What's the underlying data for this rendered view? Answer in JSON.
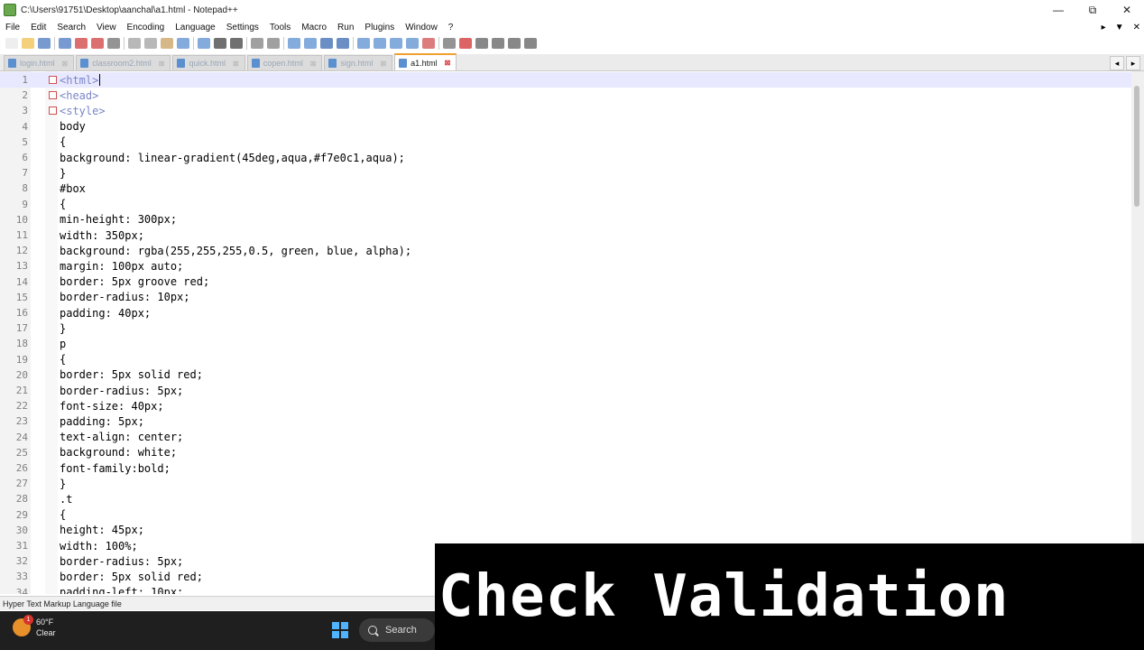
{
  "window": {
    "title": "C:\\Users\\91751\\Desktop\\aanchal\\a1.html - Notepad++",
    "minimize_glyph": "—",
    "maximize_glyph": "⧉",
    "close_glyph": "✕"
  },
  "menu": {
    "items": [
      "File",
      "Edit",
      "Search",
      "View",
      "Encoding",
      "Language",
      "Settings",
      "Tools",
      "Macro",
      "Run",
      "Plugins",
      "Window",
      "?"
    ],
    "right_controls": [
      "▸",
      "▼",
      "✕"
    ]
  },
  "tabs": [
    {
      "label": "login.html",
      "active": false
    },
    {
      "label": "classroom2.html",
      "active": false
    },
    {
      "label": "quick.html",
      "active": false
    },
    {
      "label": "copen.html",
      "active": false
    },
    {
      "label": "sign.html",
      "active": false
    },
    {
      "label": "a1.html",
      "active": true
    }
  ],
  "tab_scroll": [
    "◂",
    "▸"
  ],
  "editor": {
    "lines": [
      {
        "num": "1",
        "text": "<html>",
        "tag": true,
        "fold": "box",
        "current": true
      },
      {
        "num": "2",
        "text": "<head>",
        "tag": true,
        "fold": "box"
      },
      {
        "num": "3",
        "text": "<style>",
        "tag": true,
        "fold": "box"
      },
      {
        "num": "4",
        "text": "body"
      },
      {
        "num": "5",
        "text": "{"
      },
      {
        "num": "6",
        "text": "background: linear-gradient(45deg,aqua,#f7e0c1,aqua);"
      },
      {
        "num": "7",
        "text": "}"
      },
      {
        "num": "8",
        "text": "#box"
      },
      {
        "num": "9",
        "text": "{"
      },
      {
        "num": "10",
        "text": "min-height: 300px;"
      },
      {
        "num": "11",
        "text": "width: 350px;"
      },
      {
        "num": "12",
        "text": "background: rgba(255,255,255,0.5, green, blue, alpha);"
      },
      {
        "num": "13",
        "text": "margin: 100px auto;"
      },
      {
        "num": "14",
        "text": "border: 5px groove red;"
      },
      {
        "num": "15",
        "text": "border-radius: 10px;"
      },
      {
        "num": "16",
        "text": "padding: 40px;"
      },
      {
        "num": "17",
        "text": "}"
      },
      {
        "num": "18",
        "text": "p"
      },
      {
        "num": "19",
        "text": "{"
      },
      {
        "num": "20",
        "text": "border: 5px solid red;"
      },
      {
        "num": "21",
        "text": "border-radius: 5px;"
      },
      {
        "num": "22",
        "text": "font-size: 40px;"
      },
      {
        "num": "23",
        "text": "padding: 5px;"
      },
      {
        "num": "24",
        "text": "text-align: center;"
      },
      {
        "num": "25",
        "text": "background: white;"
      },
      {
        "num": "26",
        "text": "font-family:bold;"
      },
      {
        "num": "27",
        "text": "}"
      },
      {
        "num": "28",
        "text": ".t"
      },
      {
        "num": "29",
        "text": "{"
      },
      {
        "num": "30",
        "text": "height: 45px;"
      },
      {
        "num": "31",
        "text": "width: 100%;"
      },
      {
        "num": "32",
        "text": "border-radius: 5px;"
      },
      {
        "num": "33",
        "text": "border: 5px solid red;"
      },
      {
        "num": "34",
        "text": "padding-left: 10px;"
      }
    ]
  },
  "status": {
    "file_type": "Hyper Text Markup Language file"
  },
  "taskbar": {
    "temperature": "60°F",
    "condition": "Clear",
    "notification_count": "1",
    "search_label": "Search"
  },
  "overlay": {
    "caption": "Check Validation"
  },
  "colors": {
    "tag": "#7a86c8",
    "active_tab_accent": "#f0a030",
    "current_line": "#e8e8ff",
    "taskbar": "#1f1f1f",
    "overlay_bg": "#000000"
  },
  "icons": {
    "toolbar": [
      "new-file-icon",
      "open-file-icon",
      "save-icon",
      "save-all-icon",
      "close-icon",
      "close-all-icon",
      "print-icon",
      "cut-icon",
      "copy-icon",
      "paste-icon",
      "undo-icon",
      "redo-icon",
      "find-icon",
      "replace-icon",
      "zoom-in-icon",
      "zoom-out-icon",
      "sync-v-icon",
      "sync-h-icon",
      "word-wrap-icon",
      "show-all-chars-icon",
      "indent-guide-icon",
      "udl-icon",
      "doc-map-icon",
      "function-list-icon",
      "folder-workspace-icon",
      "monitor-icon",
      "record-macro-icon",
      "stop-macro-icon",
      "play-macro-icon",
      "run-macro-multiple-icon",
      "save-macro-icon"
    ]
  }
}
